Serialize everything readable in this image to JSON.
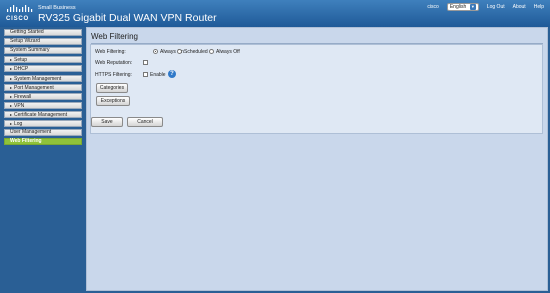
{
  "header": {
    "logo_text": "CISCO",
    "brand_small": "Small Business",
    "product_title": "RV325   Gigabit Dual WAN VPN Router",
    "user": "cisco",
    "language": "English",
    "logout": "Log Out",
    "about": "About",
    "help": "Help"
  },
  "sidebar": {
    "items": [
      {
        "label": "Getting Started",
        "arrow": ""
      },
      {
        "label": "Setup Wizard",
        "arrow": ""
      },
      {
        "label": "System Summary",
        "arrow": ""
      },
      {
        "label": "Setup",
        "arrow": "▸"
      },
      {
        "label": "DHCP",
        "arrow": "▸"
      },
      {
        "label": "System Management",
        "arrow": "▸"
      },
      {
        "label": "Port Management",
        "arrow": "▸"
      },
      {
        "label": "Firewall",
        "arrow": "▸"
      },
      {
        "label": "VPN",
        "arrow": "▸"
      },
      {
        "label": "Certificate Management",
        "arrow": "▸"
      },
      {
        "label": "Log",
        "arrow": "▸"
      },
      {
        "label": "User Management",
        "arrow": ""
      },
      {
        "label": "Web Filtering",
        "arrow": "",
        "active": true
      }
    ]
  },
  "main": {
    "page_title": "Web Filtering",
    "web_filtering_label": "Web Filtering:",
    "options": [
      "Always On",
      "Scheduled",
      "Always Off"
    ],
    "selected_option": "Always On",
    "web_reputation_label": "Web Reputation:",
    "web_reputation_checked": false,
    "https_label": "HTTPS Filtering:",
    "https_enable_label": "Enable",
    "https_enable_checked": false,
    "categories_button": "Categories",
    "exceptions_button": "Exceptions",
    "save_button": "Save",
    "cancel_button": "Cancel"
  },
  "colors": {
    "header_blue": "#2f6dad",
    "active_green": "#8fc23a",
    "panel_bg": "#dfe8f4"
  }
}
